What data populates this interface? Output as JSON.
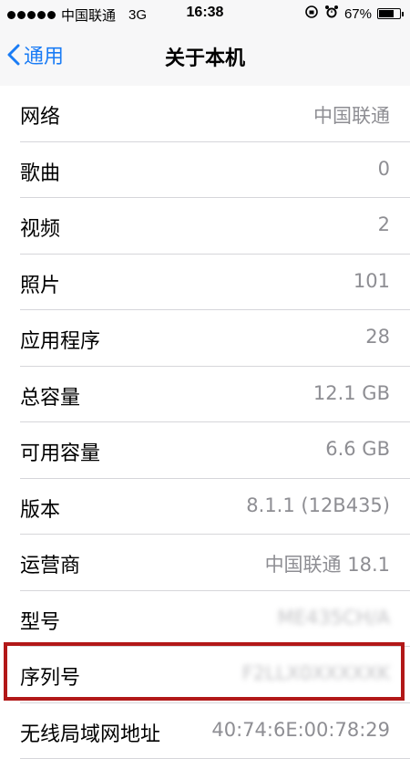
{
  "status_bar": {
    "carrier": "中国联通",
    "network": "3G",
    "time": "16:38",
    "battery": "67%",
    "battery_level": 0.67
  },
  "nav": {
    "back_label": "通用",
    "title": "关于本机"
  },
  "rows": [
    {
      "label": "网络",
      "value": "中国联通"
    },
    {
      "label": "歌曲",
      "value": "0"
    },
    {
      "label": "视频",
      "value": "2"
    },
    {
      "label": "照片",
      "value": "101"
    },
    {
      "label": "应用程序",
      "value": "28"
    },
    {
      "label": "总容量",
      "value": "12.1 GB"
    },
    {
      "label": "可用容量",
      "value": "6.6 GB"
    },
    {
      "label": "版本",
      "value": "8.1.1 (12B435)"
    },
    {
      "label": "运营商",
      "value": "中国联通 18.1"
    },
    {
      "label": "型号",
      "value": "ME435CH/A"
    },
    {
      "label": "序列号",
      "value": "F2LLX0XXXXXK"
    },
    {
      "label": "无线局域网地址",
      "value": "40:74:6E:00:78:29"
    }
  ],
  "highlight_color": "#b21818",
  "accent_color": "#1a7cf5"
}
